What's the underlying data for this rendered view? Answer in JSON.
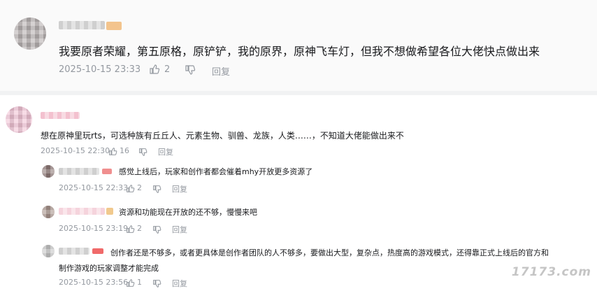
{
  "top_comment": {
    "text": "我要原者荣耀，第五原格，原铲铲，我的原界，原神飞车灯，但我不想做希望各位大佬快点做出来",
    "time": "2025-10-15 23:33",
    "likes": "2",
    "reply_label": "回复"
  },
  "main_comment": {
    "text": "想在原神里玩rts，可选种族有丘丘人、元素生物、驯兽、龙族，人类……，不知道大佬能做出来不",
    "time": "2025-10-15 22:30",
    "likes": "16",
    "reply_label": "回复"
  },
  "replies": [
    {
      "text": "感觉上线后，玩家和创作者都会催着mhy开放更多资源了",
      "time": "2025-10-15 22:33",
      "likes": "2",
      "reply_label": "回复"
    },
    {
      "text": "资源和功能现在开放的还不够，慢慢来吧",
      "time": "2025-10-15 23:19",
      "likes": "2",
      "reply_label": "回复"
    },
    {
      "text_line1": "创作者还是不够多，或者更具体是创作者团队的人不够多，要做出大型，复杂点，热度高的游戏模式，还得靠正式上线后的官方和",
      "text_line2": "制作游戏的玩家调整才能完成",
      "time": "2025-10-15 23:56",
      "likes": "1",
      "reply_label": "回复"
    }
  ],
  "watermark": "17173.com",
  "icons": {
    "like": "thumbs-up-icon",
    "dislike": "thumbs-down-icon"
  }
}
